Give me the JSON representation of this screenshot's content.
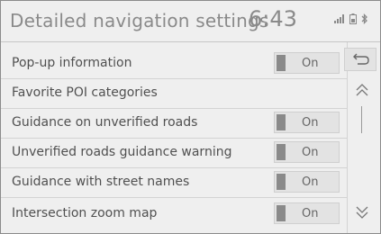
{
  "header": {
    "title": "Detailed navigation settings",
    "clock": "6:43"
  },
  "status_icons": [
    "signal-icon",
    "battery-icon",
    "bluetooth-icon"
  ],
  "settings": [
    {
      "label": "Pop-up information",
      "value": "On"
    },
    {
      "label": "Favorite POI categories",
      "value": null
    },
    {
      "label": "Guidance on unverified roads",
      "value": "On"
    },
    {
      "label": "Unverified roads guidance warning",
      "value": "On"
    },
    {
      "label": "Guidance with street names",
      "value": "On"
    },
    {
      "label": "Intersection zoom map",
      "value": "On"
    }
  ],
  "sidebar": {
    "back_icon": "back-icon",
    "up_icon": "chevron-up-icon",
    "down_icon": "chevron-down-icon"
  }
}
